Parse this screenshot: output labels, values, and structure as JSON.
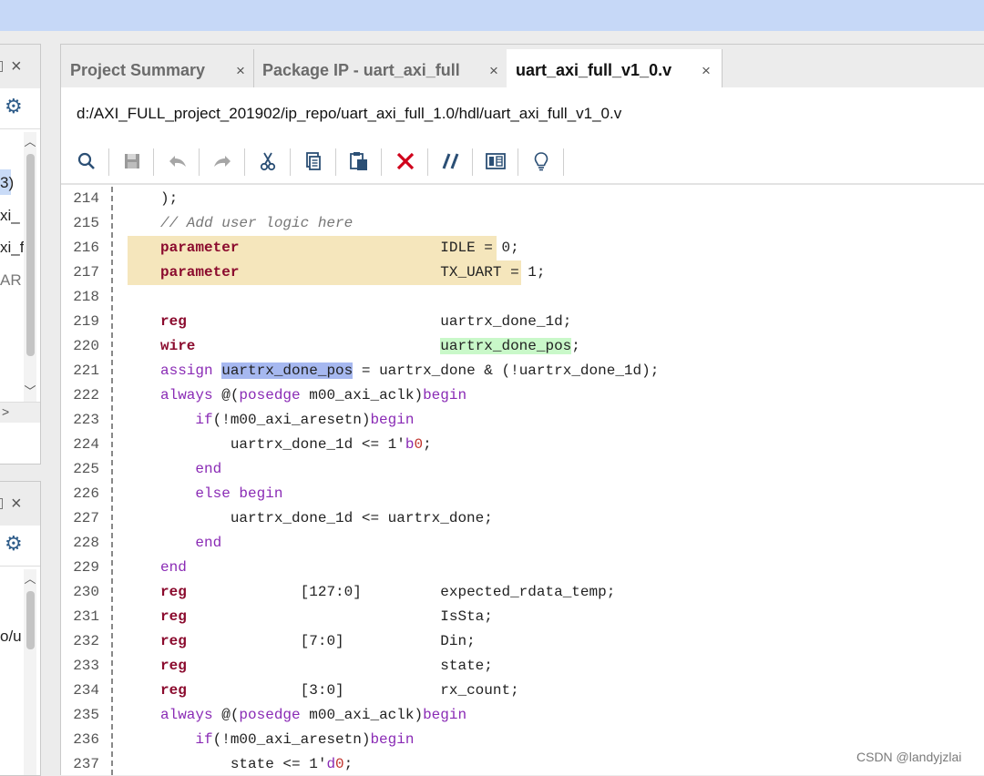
{
  "left_panels": {
    "top": {
      "text_items": [
        "3)",
        "xi_",
        "xi_f",
        "AR"
      ]
    },
    "bottom": {
      "text_items": [
        "o/u"
      ]
    }
  },
  "editor": {
    "tabs": [
      {
        "label": "Project Summary",
        "active": false
      },
      {
        "label": "Package IP - uart_axi_full",
        "active": false
      },
      {
        "label": "uart_axi_full_v1_0.v",
        "active": true
      }
    ],
    "close_glyph": "×",
    "file_path": "d:/AXI_FULL_project_201902/ip_repo/uart_axi_full_1.0/hdl/uart_axi_full_v1_0.v",
    "toolbar": [
      {
        "name": "search-icon"
      },
      {
        "name": "save-icon"
      },
      {
        "name": "undo-icon"
      },
      {
        "name": "redo-icon"
      },
      {
        "name": "cut-icon"
      },
      {
        "name": "copy-icon"
      },
      {
        "name": "paste-icon"
      },
      {
        "name": "delete-icon"
      },
      {
        "name": "comment-icon"
      },
      {
        "name": "columns-icon"
      },
      {
        "name": "lightbulb-icon"
      }
    ],
    "colors": {
      "keyword": "#8b0b2e",
      "keyword2": "#8a2bb5",
      "comment": "#777777",
      "number": "#c0322b",
      "highlight_yellow": "#f5e6bc",
      "highlight_green": "#c9f8c9",
      "highlight_blue": "#a6b8f0",
      "delete_red": "#d0021b"
    },
    "code_lines": [
      {
        "num": "214",
        "text": "    );"
      },
      {
        "num": "215",
        "text": "    // Add user logic here"
      },
      {
        "num": "216",
        "text": "    parameter                       IDLE = 0;",
        "highlight": "yellow"
      },
      {
        "num": "217",
        "text": "    parameter                       TX_UART = 1;",
        "highlight": "yellow"
      },
      {
        "num": "218",
        "text": ""
      },
      {
        "num": "219",
        "text": "    reg                             uartrx_done_1d;"
      },
      {
        "num": "220",
        "text": "    wire                            uartrx_done_pos;"
      },
      {
        "num": "221",
        "text": "    assign uartrx_done_pos = uartrx_done & (!uartrx_done_1d);"
      },
      {
        "num": "222",
        "text": "    always @(posedge m00_axi_aclk)begin"
      },
      {
        "num": "223",
        "text": "        if(!m00_axi_aresetn)begin"
      },
      {
        "num": "224",
        "text": "            uartrx_done_1d <= 1'b0;"
      },
      {
        "num": "225",
        "text": "        end"
      },
      {
        "num": "226",
        "text": "        else begin"
      },
      {
        "num": "227",
        "text": "            uartrx_done_1d <= uartrx_done;"
      },
      {
        "num": "228",
        "text": "        end"
      },
      {
        "num": "229",
        "text": "    end"
      },
      {
        "num": "230",
        "text": "    reg             [127:0]         expected_rdata_temp;"
      },
      {
        "num": "231",
        "text": "    reg                             IsSta;"
      },
      {
        "num": "232",
        "text": "    reg             [7:0]           Din;"
      },
      {
        "num": "233",
        "text": "    reg                             state;"
      },
      {
        "num": "234",
        "text": "    reg             [3:0]           rx_count;"
      },
      {
        "num": "235",
        "text": "    always @(posedge m00_axi_aclk)begin"
      },
      {
        "num": "236",
        "text": "        if(!m00_axi_aresetn)begin"
      },
      {
        "num": "237",
        "text": "            state <= 1'd0;"
      }
    ]
  },
  "watermark": "CSDN @landyjzlai"
}
